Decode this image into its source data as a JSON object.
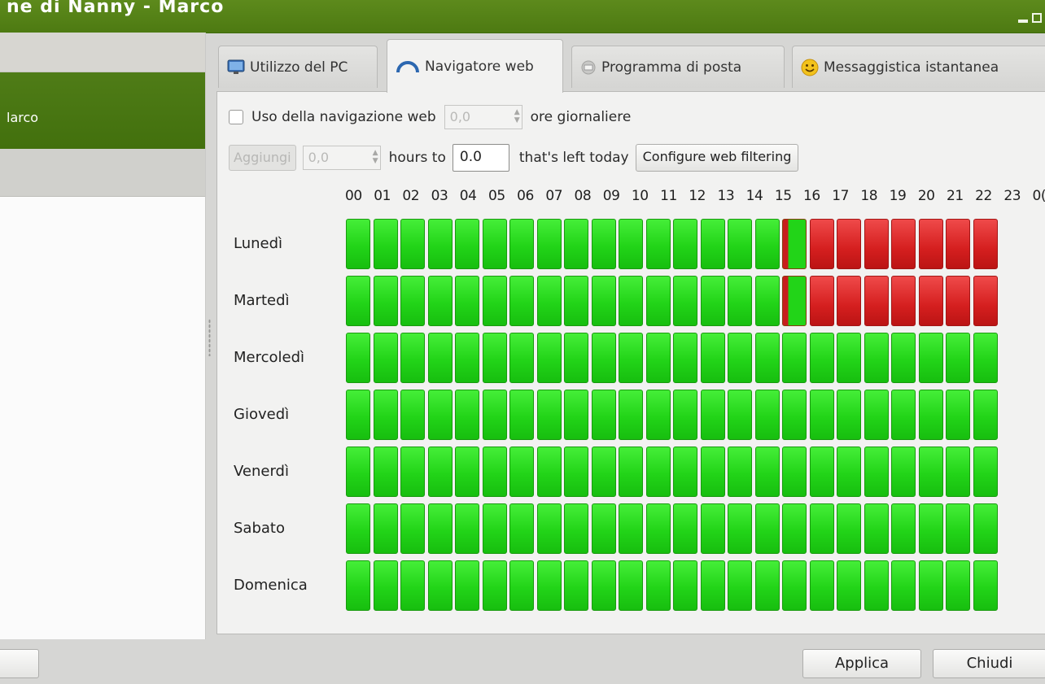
{
  "window": {
    "title": "ne di Nanny - Marco"
  },
  "sidebar": {
    "items": [
      {
        "label": ""
      },
      {
        "label": "larco"
      },
      {
        "label": ""
      }
    ]
  },
  "tabs": [
    {
      "label": "Utilizzo del PC",
      "icon": "monitor-icon",
      "active": false
    },
    {
      "label": "Navigatore web",
      "icon": "web-browser-icon",
      "active": true
    },
    {
      "label": "Programma di posta",
      "icon": "mail-icon",
      "active": false
    },
    {
      "label": "Messaggistica istantanea",
      "icon": "smiley-icon",
      "active": false
    }
  ],
  "controls": {
    "limit_checkbox_label": "Uso della navigazione web",
    "daily_hours_value": "0,0",
    "daily_hours_unit": "ore giornaliere",
    "add_button": "Aggiungi",
    "add_hours_value": "0,0",
    "hours_to_label": "hours to",
    "remaining_value": "0.0",
    "left_today_label": "that's left today",
    "configure_filter_button": "Configure web filtering"
  },
  "schedule": {
    "hours": [
      "00",
      "01",
      "02",
      "03",
      "04",
      "05",
      "06",
      "07",
      "08",
      "09",
      "10",
      "11",
      "12",
      "13",
      "14",
      "15",
      "16",
      "17",
      "18",
      "19",
      "20",
      "21",
      "22",
      "23",
      "0("
    ],
    "days": [
      {
        "label": "Lunedì",
        "blocked_from_hour": 17
      },
      {
        "label": "Martedì",
        "blocked_from_hour": 17
      },
      {
        "label": "Mercoledì",
        "blocked_from_hour": null
      },
      {
        "label": "Giovedì",
        "blocked_from_hour": null
      },
      {
        "label": "Venerdì",
        "blocked_from_hour": null
      },
      {
        "label": "Sabato",
        "blocked_from_hour": null
      },
      {
        "label": "Domenica",
        "blocked_from_hour": null
      }
    ],
    "colors": {
      "allowed": "#22d418",
      "blocked": "#d51f1f"
    }
  },
  "footer": {
    "apply_button": "Applica",
    "close_button": "Chiudi"
  }
}
